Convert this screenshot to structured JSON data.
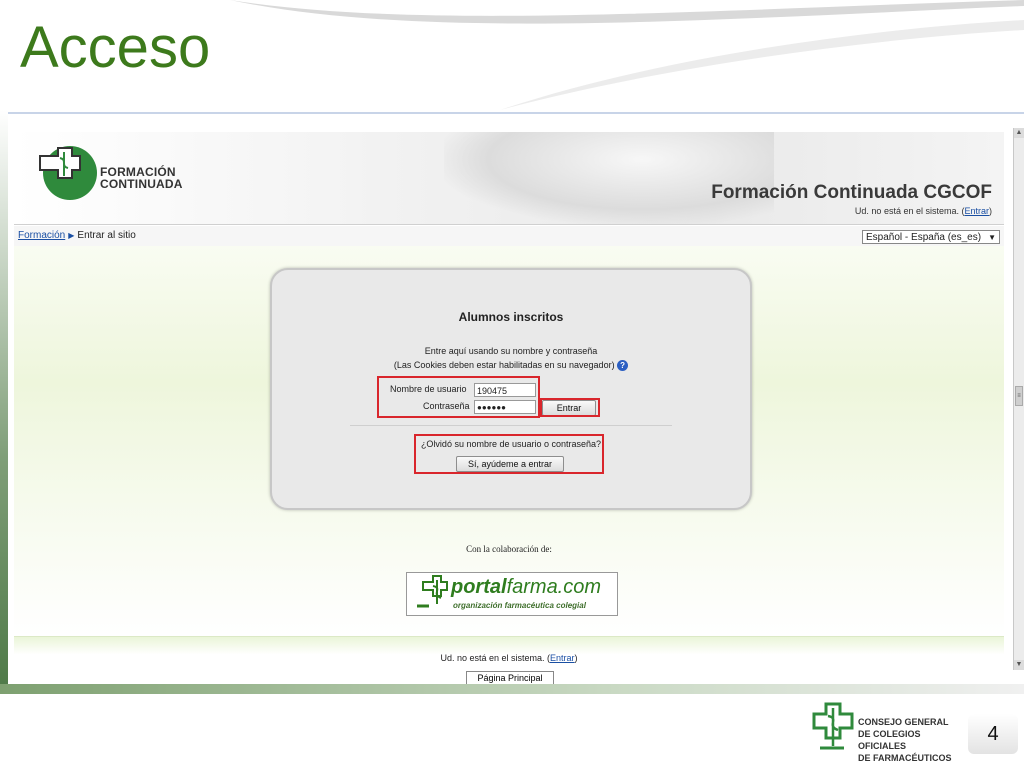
{
  "slide": {
    "title": "Acceso",
    "slide_number": "4"
  },
  "site": {
    "logo_line1": "FORMACIÓN",
    "logo_line2": "CONTINUADA",
    "title": "Formación Continuada CGCOF",
    "login_status_prefix": "Ud. no está en el sistema. (",
    "login_status_link": "Entrar",
    "login_status_suffix": ")"
  },
  "navbar": {
    "breadcrumb_home": "Formación",
    "breadcrumb_current": "Entrar al sitio",
    "language_selected": "Español - España (es_es)"
  },
  "login": {
    "heading": "Alumnos inscritos",
    "instruction_line1": "Entre aquí usando su nombre y contraseña",
    "instruction_line2": "(Las Cookies deben estar habilitadas en su navegador)",
    "username_label": "Nombre de usuario",
    "username_value": "190475",
    "password_label": "Contraseña",
    "password_value": "●●●●●●",
    "submit_label": "Entrar",
    "forgot_text": "¿Olvidó su nombre de usuario o contraseña?",
    "forgot_button": "Sí, ayúdeme a entrar"
  },
  "collab": {
    "text": "Con la colaboración de:",
    "brand_a": "portal",
    "brand_b": "farma.com",
    "brand_sub": "organización farmacéutica colegial"
  },
  "footer": {
    "status_prefix": "Ud. no está en el sistema. (",
    "status_link": "Entrar",
    "status_suffix": ")",
    "home_button": "Página Principal"
  },
  "cgcof": {
    "line1": "CONSEJO GENERAL",
    "line2": "DE COLEGIOS OFICIALES",
    "line3": "DE FARMACÉUTICOS"
  },
  "colors": {
    "title_green": "#3d7a1c",
    "highlight_red": "#d9262c",
    "link_blue": "#1a4fa3"
  }
}
